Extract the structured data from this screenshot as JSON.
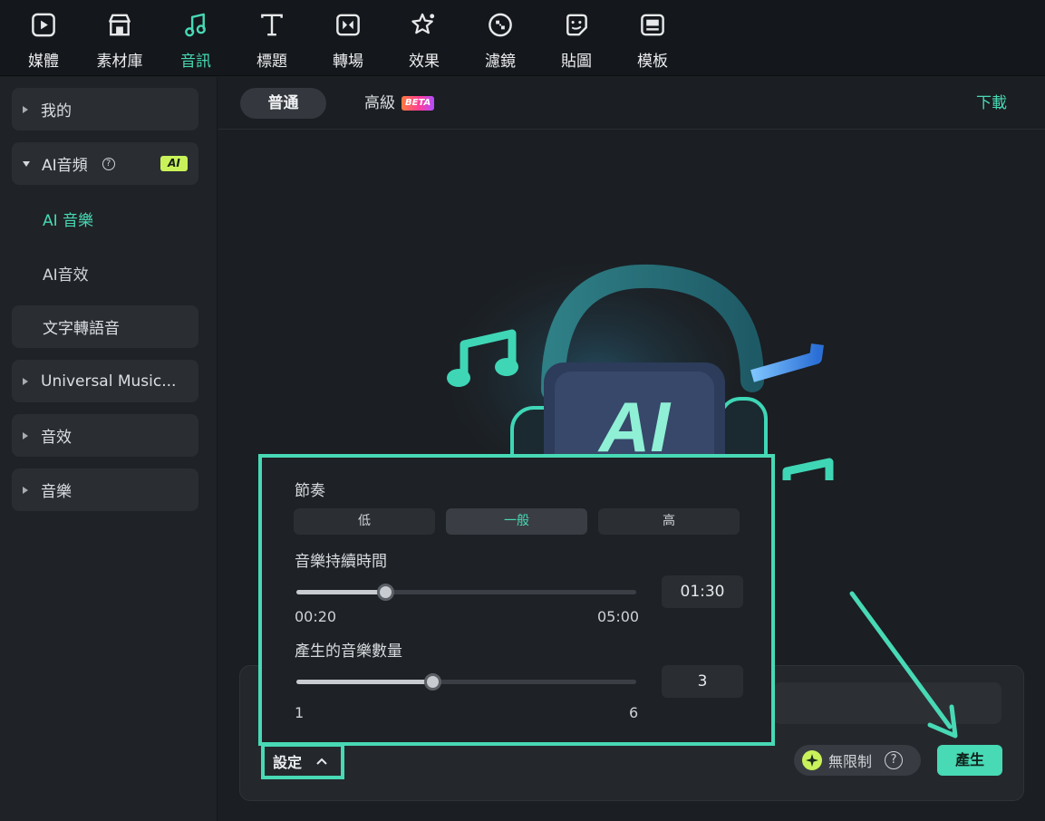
{
  "toolbar": {
    "items": [
      {
        "label": "媒體",
        "icon": "media-icon"
      },
      {
        "label": "素材庫",
        "icon": "stock-library-icon"
      },
      {
        "label": "音訊",
        "icon": "music-note-icon",
        "active": true
      },
      {
        "label": "標題",
        "icon": "title-text-icon"
      },
      {
        "label": "轉場",
        "icon": "transition-icon"
      },
      {
        "label": "效果",
        "icon": "effects-star-icon"
      },
      {
        "label": "濾鏡",
        "icon": "filter-icon"
      },
      {
        "label": "貼圖",
        "icon": "sticker-icon"
      },
      {
        "label": "模板",
        "icon": "template-icon"
      }
    ]
  },
  "sidebar": {
    "my": "我的",
    "ai_audio": "AI音頻",
    "ai_badge": "AI",
    "ai_music": "AI 音樂",
    "ai_sfx": "AI音效",
    "tts": "文字轉語音",
    "universal": "Universal Music...",
    "sound_effects": "音效",
    "music": "音樂"
  },
  "header": {
    "tab_basic": "普通",
    "tab_advanced": "高級",
    "beta_badge": "BETA",
    "download": "下載"
  },
  "hero": {
    "ai_text": "AI"
  },
  "settings": {
    "tempo_label": "節奏",
    "tempo_options": [
      "低",
      "一般",
      "高"
    ],
    "tempo_selected": "一般",
    "duration_label": "音樂持續時間",
    "duration_min": "00:20",
    "duration_max": "05:00",
    "duration_value": "01:30",
    "duration_fraction": 0.26,
    "count_label": "產生的音樂數量",
    "count_min": "1",
    "count_max": "6",
    "count_value": "3",
    "count_fraction": 0.4
  },
  "footer": {
    "settings_toggle": "設定",
    "credits": "無限制",
    "generate": "產生"
  },
  "colors": {
    "accent": "#48d9b5",
    "ai_badge": "#c9f25a",
    "background": "#1b1e22"
  }
}
